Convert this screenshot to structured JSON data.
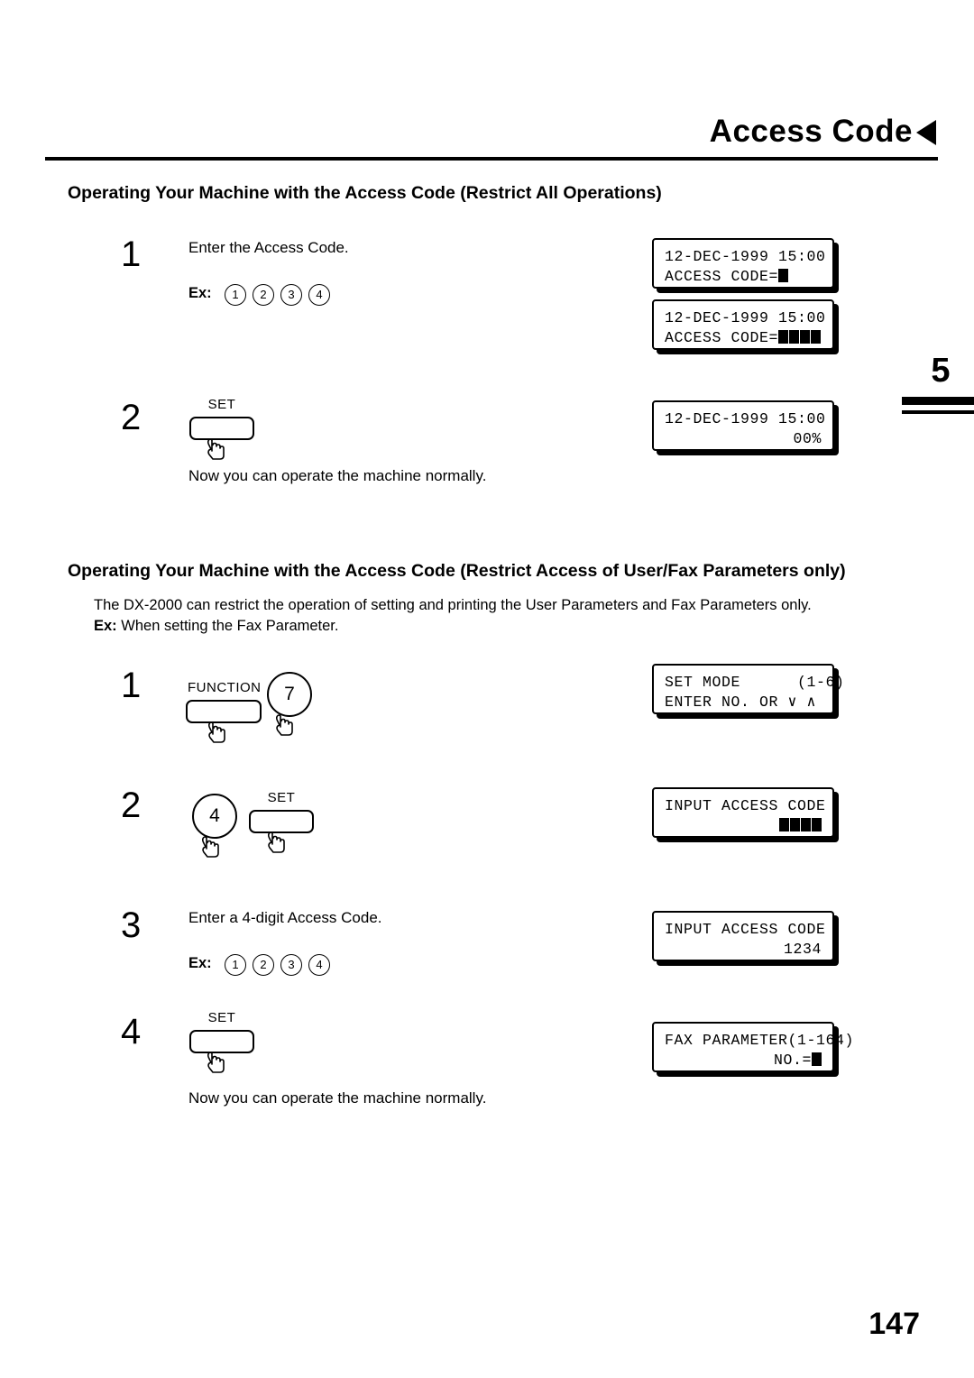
{
  "header": {
    "title": "Access Code",
    "arrow_icon": "left-triangle-icon",
    "side_tab_number": "5"
  },
  "footer": {
    "page_number": "147"
  },
  "section1": {
    "heading": "Operating Your Machine with the Access Code (Restrict All Operations)",
    "steps": [
      {
        "number": "1",
        "text": "Enter the Access Code.",
        "ex_label": "Ex:",
        "keys": [
          "1",
          "2",
          "3",
          "4"
        ]
      },
      {
        "number": "2",
        "key_label": "SET",
        "after_text": "Now you can operate the machine normally."
      }
    ],
    "displays": [
      {
        "line1": "12-DEC-1999 15:00",
        "line2": "ACCESS CODE=",
        "blocks2": 1
      },
      {
        "line1": "12-DEC-1999 15:00",
        "line2": "ACCESS CODE=",
        "blocks2": 4
      },
      {
        "line1": "12-DEC-1999 15:00",
        "line2": "00%",
        "blocks2": 0
      }
    ]
  },
  "section2": {
    "heading": "Operating Your Machine with the Access Code (Restrict Access of User/Fax Parameters only)",
    "para1": "The DX-2000 can restrict the operation of setting and printing the User Parameters and Fax Parameters only.",
    "para2_bold": "Ex:",
    "para2": " When setting the Fax Parameter.",
    "steps": [
      {
        "number": "1",
        "key1_label": "FUNCTION",
        "key2_label": "7"
      },
      {
        "number": "2",
        "key1_label": "4",
        "key2_label": "SET"
      },
      {
        "number": "3",
        "text": "Enter a 4-digit Access Code.",
        "ex_label": "Ex:",
        "keys": [
          "1",
          "2",
          "3",
          "4"
        ]
      },
      {
        "number": "4",
        "key_label": "SET",
        "after_text": "Now you can operate the machine normally."
      }
    ],
    "displays": [
      {
        "line1": "SET MODE      (1-6)",
        "line2": "ENTER NO. OR ∨ ∧"
      },
      {
        "line1": "INPUT ACCESS CODE",
        "line2": "",
        "blocks2": 4
      },
      {
        "line1": "INPUT ACCESS CODE",
        "line2": "1234"
      },
      {
        "line1": "FAX PARAMETER(1-164)",
        "line2": "NO.=",
        "blocks2": 1
      }
    ]
  }
}
